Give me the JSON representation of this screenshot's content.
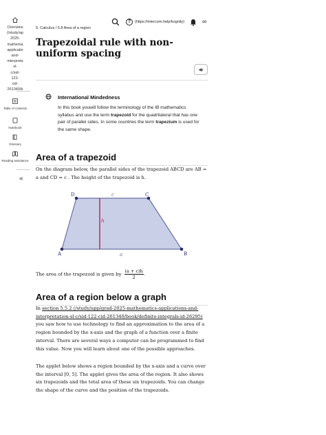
{
  "sidebar": {
    "overview_label": "Overview\n(/study/ap\n2025-\nmathema\napplicatio\nand-\ninterpreta\nsl-\nc/sid-\n122-\ncid-\n261340/b",
    "items": [
      {
        "label": "Table of contents",
        "icon": "table-of-contents-icon"
      },
      {
        "label": "Notebook",
        "icon": "notebook-icon"
      },
      {
        "label": "Glossary",
        "icon": "glossary-icon"
      },
      {
        "label": "Reading assistance",
        "icon": "reading-assistance-icon"
      }
    ],
    "collapse_glyph": "«"
  },
  "topbar": {
    "breadcrumb": "5. Calculus / 5.8 Area of a region",
    "help_glyph": "?",
    "help_link": "(https://intercom.help/kognity)",
    "infinity_glyph": "∞"
  },
  "title": {
    "text": "Trapezoidal rule with non-uniform spacing",
    "action_glyph": "🔊"
  },
  "callout": {
    "title": "International Mindedness",
    "body_1": "In this book youwill follow the terminology of the IB mathematics syllabus and use the term ",
    "term_1": "trapezoid",
    "body_2": " for the quadrilateral that has one pair of parallel sides. In some countries the term ",
    "term_2": "trapezium",
    "body_3": " is used for the same shape."
  },
  "section1": {
    "heading": "Area of a trapezoid",
    "para_1": "On the diagram below, the parallel sides of the trapezoid ABCD are AB = a and CD = c . The height of the trapezoid is h.",
    "area_text": "The area of the trapezoid is given by",
    "area_num": "(a + c)h",
    "area_den": "2",
    "area_end": "."
  },
  "diagram": {
    "vertex_a": "A",
    "vertex_b": "B",
    "vertex_c": "C",
    "vertex_d": "D",
    "label_top": "c",
    "label_bottom": "a",
    "label_height": "h",
    "fill_color": "#c9cfe6",
    "edge_color": "#6a6fa3",
    "height_color": "#c2185b",
    "point_color": "#2d2a6e"
  },
  "section2": {
    "heading": "Area of a region below a graph",
    "para_1_pre": "In ",
    "para_1_link": "section 5.5.2 (/study/app/grad-2025-mathematics-applications-and-interpretation-sl-c/sid-122-cid-261340/book/definite-integrals-id-26295)",
    "para_1_post": " you saw how to use technology to find an approximation to the area of a region bounded by the x-axis and the graph of a function over a finite interval. There are several ways a computer can be programmed to find this value. Now you will learn about one of the possible approaches.",
    "para_2": "The applet below shows a region bounded by the x-axis and a curve over the interval [0, 5]. The applet gives the area of the region. It also shows six trapezoids and the total area of these six trapezoids. You can change the shape of the curve and the position of the trapezoids."
  }
}
